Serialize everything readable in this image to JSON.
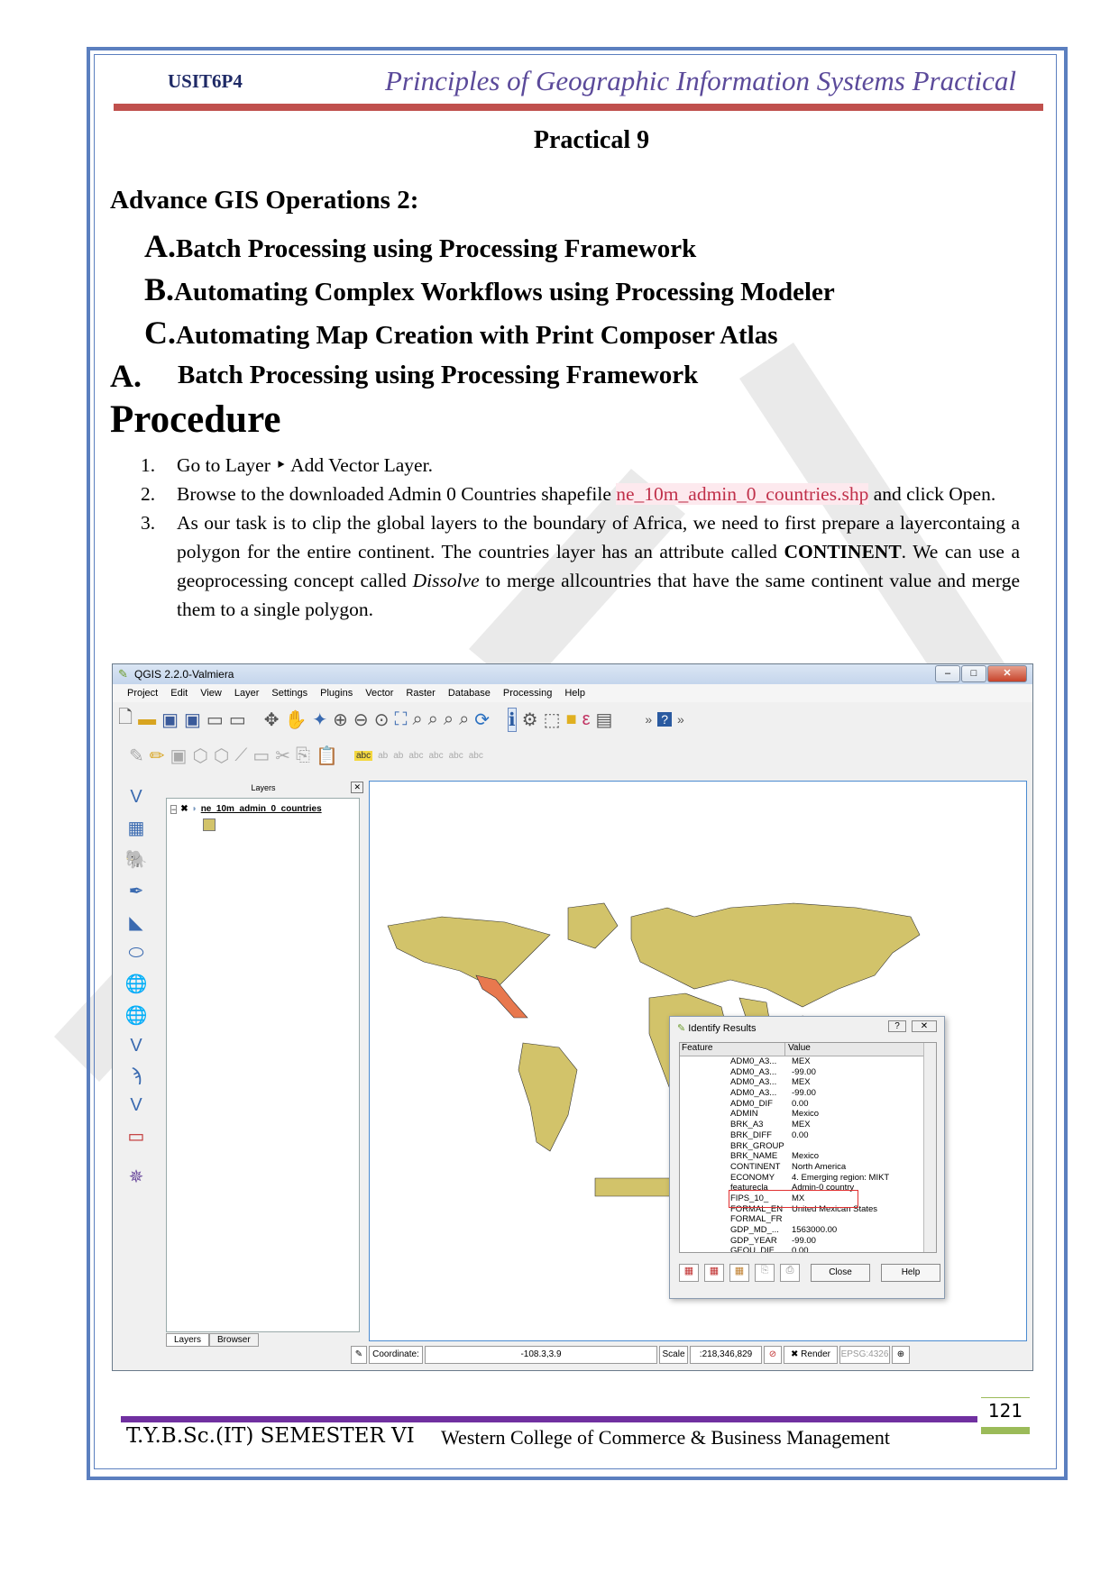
{
  "header": {
    "code": "USIT6P4",
    "title": "Principles of Geographic Information Systems Practical"
  },
  "practical_title": "Practical 9",
  "section_heading": "Advance GIS Operations 2:",
  "subheadings": [
    {
      "letter": "A.",
      "text": "Batch Processing using Processing Framework"
    },
    {
      "letter": "B.",
      "text": "Automating Complex Workflows using Processing Modeler"
    },
    {
      "letter": "C.",
      "text": "Automating Map Creation with Print Composer Atlas"
    }
  ],
  "part_heading": {
    "letter": "A.",
    "text": "Batch Processing using Processing Framework"
  },
  "procedure_heading": "Procedure",
  "steps": [
    {
      "num": "1.",
      "pre": "Go to Layer ‣  Add Vector Layer."
    },
    {
      "num": "2.",
      "pre": "Browse to the downloaded Admin 0 Countries shapefile ",
      "file": "ne_10m_admin_0_countries.shp",
      "post": " and click Open."
    },
    {
      "num": "3.",
      "pre": "As our task is to clip the global layers to the boundary of Africa, we need to first prepare a layercontaing a polygon for the entire continent. The countries layer has an attribute called ",
      "bold": "CONTINENT",
      "mid": ". We can use a geoprocessing concept called ",
      "italic": "Dissolve",
      "post": " to merge allcountries that have the same continent value and merge them to a single polygon."
    }
  ],
  "qgis": {
    "window_title": "QGIS 2.2.0-Valmiera",
    "menu": [
      "Project",
      "Edit",
      "View",
      "Layer",
      "Settings",
      "Plugins",
      "Vector",
      "Raster",
      "Database",
      "Processing",
      "Help"
    ],
    "layers_panel_title": "Layers",
    "layer_name": "ne_10m_admin_0_countries",
    "panel_tabs": [
      "Layers",
      "Browser"
    ],
    "status": {
      "coordinate_label": "Coordinate:",
      "coordinate": "-108.3,3.9",
      "scale_label": "Scale",
      "scale": ":218,346,829",
      "render": "Render",
      "epsg": "EPSG:4326"
    },
    "identify": {
      "title": "Identify Results",
      "col_feature": "Feature",
      "col_value": "Value",
      "rows": [
        [
          "ADM0_A3...",
          "MEX"
        ],
        [
          "ADM0_A3...",
          "-99.00"
        ],
        [
          "ADM0_A3...",
          "MEX"
        ],
        [
          "ADM0_A3...",
          "-99.00"
        ],
        [
          "ADM0_DIF",
          "0.00"
        ],
        [
          "ADMIN",
          "Mexico"
        ],
        [
          "BRK_A3",
          "MEX"
        ],
        [
          "BRK_DIFF",
          "0.00"
        ],
        [
          "BRK_GROUP",
          ""
        ],
        [
          "BRK_NAME",
          "Mexico"
        ],
        [
          "CONTINENT",
          "North America"
        ],
        [
          "ECONOMY",
          "4. Emerging region: MIKT"
        ],
        [
          "featurecla",
          "Admin-0 country"
        ],
        [
          "FIPS_10_",
          "MX"
        ],
        [
          "FORMAL_EN",
          "United Mexican States"
        ],
        [
          "FORMAL_FR",
          ""
        ],
        [
          "GDP_MD_...",
          "1563000.00"
        ],
        [
          "GDP_YEAR",
          "-99.00"
        ],
        [
          "GEOU_DIF",
          "0.00"
        ]
      ],
      "close_label": "Close",
      "help_label": "Help"
    }
  },
  "footer": {
    "left": "T.Y.B.Sc.(IT) SEMESTER VI",
    "right": "Western College of Commerce & Business Management",
    "page": "121"
  },
  "colors": {
    "frame": "#5b7fbf",
    "header_rule": "#c0504d",
    "footer_rule": "#7030a0",
    "page_bar": "#9bbb59",
    "land": "#d2c36a",
    "highlight": "#e8784e"
  }
}
